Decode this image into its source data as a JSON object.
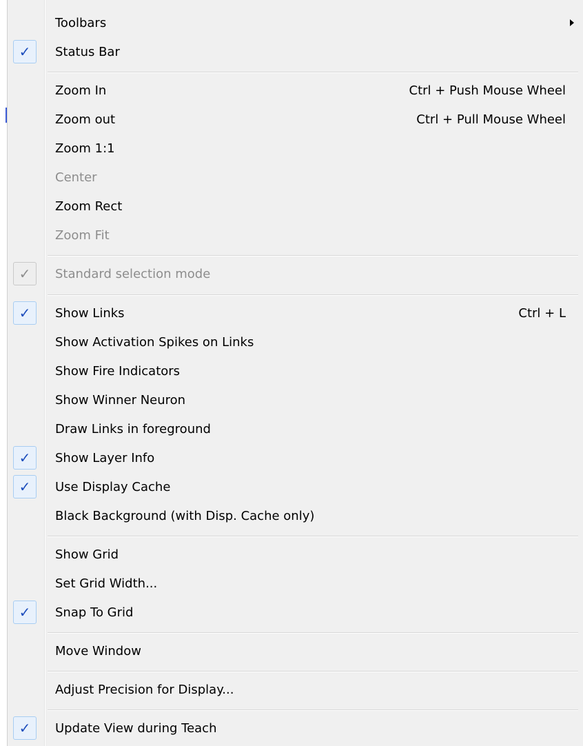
{
  "menu": {
    "items": [
      {
        "label": "Toolbars",
        "shortcut": "",
        "checked": false,
        "disabled": false,
        "submenu": true,
        "icon": "submenu-arrow-icon"
      },
      {
        "label": "Status Bar",
        "shortcut": "",
        "checked": true,
        "disabled": false
      },
      {
        "label": "Zoom In",
        "shortcut": "Ctrl + Push Mouse Wheel",
        "checked": false,
        "disabled": false
      },
      {
        "label": "Zoom out",
        "shortcut": "Ctrl + Pull Mouse Wheel",
        "checked": false,
        "disabled": false
      },
      {
        "label": "Zoom 1:1",
        "shortcut": "",
        "checked": false,
        "disabled": false
      },
      {
        "label": "Center",
        "shortcut": "",
        "checked": false,
        "disabled": true
      },
      {
        "label": "Zoom Rect",
        "shortcut": "",
        "checked": false,
        "disabled": false
      },
      {
        "label": "Zoom Fit",
        "shortcut": "",
        "checked": false,
        "disabled": true
      },
      {
        "label": "Standard selection mode",
        "shortcut": "",
        "checked": true,
        "disabled": true
      },
      {
        "label": "Show Links",
        "shortcut": "Ctrl + L",
        "checked": true,
        "disabled": false
      },
      {
        "label": "Show Activation Spikes on Links",
        "shortcut": "",
        "checked": false,
        "disabled": false
      },
      {
        "label": "Show Fire Indicators",
        "shortcut": "",
        "checked": false,
        "disabled": false
      },
      {
        "label": "Show Winner Neuron",
        "shortcut": "",
        "checked": false,
        "disabled": false
      },
      {
        "label": "Draw Links in foreground",
        "shortcut": "",
        "checked": false,
        "disabled": false
      },
      {
        "label": "Show Layer Info",
        "shortcut": "",
        "checked": true,
        "disabled": false
      },
      {
        "label": "Use Display Cache",
        "shortcut": "",
        "checked": true,
        "disabled": false
      },
      {
        "label": "Black Background (with Disp. Cache only)",
        "shortcut": "",
        "checked": false,
        "disabled": false
      },
      {
        "label": "Show Grid",
        "shortcut": "",
        "checked": false,
        "disabled": false
      },
      {
        "label": "Set Grid Width...",
        "shortcut": "",
        "checked": false,
        "disabled": false
      },
      {
        "label": "Snap To Grid",
        "shortcut": "",
        "checked": true,
        "disabled": false
      },
      {
        "label": "Move Window",
        "shortcut": "",
        "checked": false,
        "disabled": false
      },
      {
        "label": "Adjust Precision for Display...",
        "shortcut": "",
        "checked": false,
        "disabled": false
      },
      {
        "label": "Update View during Teach",
        "shortcut": "",
        "checked": true,
        "disabled": false
      }
    ],
    "checkmark_glyph": "✓",
    "colors": {
      "background": "#f0f0f0",
      "text": "#000000",
      "disabled_text": "#8d8d8d",
      "check_accent": "#1c4dbc",
      "check_box_bg": "#e8f1fc",
      "check_box_border": "#a8cdf2"
    }
  }
}
